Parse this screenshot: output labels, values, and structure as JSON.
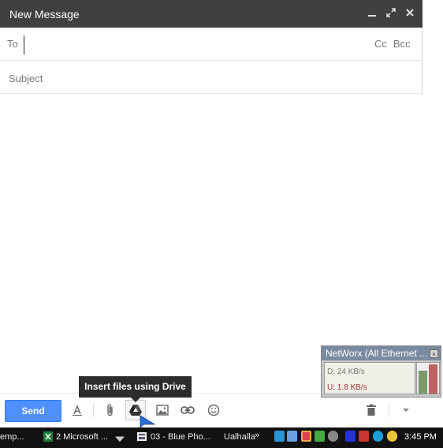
{
  "compose": {
    "title": "New Message",
    "controls": {
      "minimize": "▁",
      "expand": "⤢",
      "close": "✕"
    },
    "to_label": "To",
    "to_value": "",
    "cc_label": "Cc",
    "bcc_label": "Bcc",
    "subject_placeholder": "Subject",
    "subject_value": "",
    "body_value": ""
  },
  "toolbar": {
    "send_label": "Send",
    "tooltip": "Insert files using Drive",
    "icons": [
      "formatting-icon",
      "attach-icon",
      "drive-icon",
      "photo-icon",
      "link-icon",
      "emoji-icon",
      "trash-icon",
      "more-options-icon"
    ],
    "accent": "#4d90fe"
  },
  "networx": {
    "title": "NetWorx (All Ethernet ...",
    "close": "×",
    "download": "D: 24 KB/s",
    "upload": "U: 1.8 KB/s",
    "download_level": 0.75,
    "upload_level": 0.95
  },
  "taskbar": {
    "items": [
      "emp...",
      "2 Microsoft ...",
      "03 - Blue Pho...",
      "Ualhalla"
    ],
    "overflow": "»",
    "clock": "3:45 PM"
  }
}
